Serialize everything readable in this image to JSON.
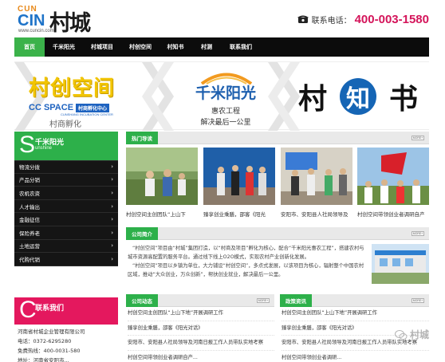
{
  "header": {
    "logo_cun": "CUN",
    "logo_cin": "CIN",
    "logo_cheng": "村城",
    "logo_url": "www.cuncin.com",
    "phone_label": "联系电话：",
    "phone_number": "400-003-1580"
  },
  "nav": {
    "items": [
      {
        "label": "首页",
        "active": true
      },
      {
        "label": "千米阳光"
      },
      {
        "label": "村城项目"
      },
      {
        "label": "村创空间"
      },
      {
        "label": "村知书"
      },
      {
        "label": "村测"
      },
      {
        "label": "联系我们"
      }
    ]
  },
  "banner": {
    "b1_title": "村创空间",
    "b1_cc": "CC SPACE",
    "b1_box": "村商孵化中心",
    "b1_sub2": "CUNSHANG INCUBATION CENTER",
    "b1_tag": "村商孵化",
    "b2_title": "千米阳光",
    "b2_sub": "惠农工程",
    "b2_sub2": "解决最后一公里",
    "b3_left": "村",
    "b3_mid": "知",
    "b3_right": "书"
  },
  "sidebar": {
    "head_big": "S",
    "head_title": "千米阳光",
    "head_sub": "unshine",
    "items": [
      {
        "label": "物流分拨"
      },
      {
        "label": "产品分销"
      },
      {
        "label": "农机农资"
      },
      {
        "label": "人才输出"
      },
      {
        "label": "金融征信"
      },
      {
        "label": "保险养老"
      },
      {
        "label": "土地运营"
      },
      {
        "label": "代购代销"
      }
    ]
  },
  "contact": {
    "big": "C",
    "title": "联系我们",
    "lines": [
      "河南省村城企业管理有限公司",
      "电话：0372-6295280",
      "免费热线：400-0031-580",
      "地址：河南省安阳市..."
    ]
  },
  "hot": {
    "tab": "热门导读",
    "more": "MORE+",
    "captions": [
      "村创空间主创团队“上山下",
      "臻享创业乘膳，邵客《阳光",
      "安阳市、安阳县人社局领导及",
      "村创空间带领创业者调研自产"
    ]
  },
  "intro": {
    "tab": "公司简介",
    "more": "MORE+",
    "p1": "“村创空间”项目由“村城”集团打造，以“村商及项目”孵化为核心，配合“千米阳光惠农工程”，搭建农村与城市资源高配置的服务平台。通过线下线上O2O模式，实现农村产业创新化发展。",
    "p2": "“村创空间”项目以乡镇为单位，大力铺设“村创空间”，多点式发展，以该项目为核心，辐射整个中国农村区域，推动“大众创业，万众创新”，帮扶创业就业，解决最后一公里。"
  },
  "news": {
    "tab": "公司动态",
    "more": "MORE+",
    "items": [
      "村创空间主创团队“上山下地”开展调研工作",
      "臻享创业乘膳，邵客《阳光对话》",
      "安阳市、安阳县人社局领导及河南日报工作人员带队实地考察",
      "村创空间带领创业者调研自产..."
    ]
  },
  "policy": {
    "tab": "政策资讯",
    "more": "MORE+",
    "items": [
      "村创空间主创团队“上山下地”开展调研工作",
      "臻享创业乘膳，邵客《阳光对话》",
      "安阳市、安阳县人社局领导及河南日报工作人员带队实地考察",
      "村创空间带领创业者调研..."
    ]
  },
  "watermark": {
    "text": "村城"
  },
  "colors": {
    "green": "#2db04a",
    "pink": "#e4185e",
    "nav_bg": "#0c0c0c",
    "phone": "#d4145a"
  }
}
